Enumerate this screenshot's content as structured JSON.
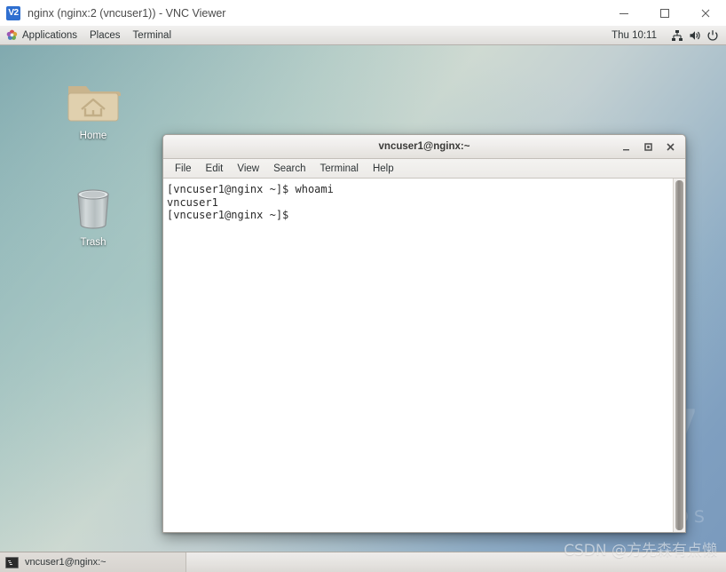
{
  "vnc_window": {
    "app_icon_text": "V2",
    "title": "nginx (nginx:2 (vncuser1)) - VNC Viewer",
    "buttons": {
      "minimize": "minimize-icon",
      "maximize": "maximize-icon",
      "close": "close-icon"
    }
  },
  "gnome_panel": {
    "applications_label": "Applications",
    "places_label": "Places",
    "terminal_label": "Terminal",
    "clock": "Thu 10:11",
    "tray": [
      {
        "name": "network-icon"
      },
      {
        "name": "volume-icon"
      },
      {
        "name": "power-icon"
      }
    ]
  },
  "desktop": {
    "wallpaper_brand_number": "7",
    "wallpaper_brand_text": "ntOS",
    "icons": [
      {
        "name": "home",
        "label": "Home"
      },
      {
        "name": "trash",
        "label": "Trash"
      }
    ]
  },
  "terminal": {
    "title": "vncuser1@nginx:~",
    "menus": [
      {
        "label": "File"
      },
      {
        "label": "Edit"
      },
      {
        "label": "View"
      },
      {
        "label": "Search"
      },
      {
        "label": "Terminal"
      },
      {
        "label": "Help"
      }
    ],
    "buttons": {
      "minimize": "minimize-icon",
      "maximize": "maximize-icon",
      "close": "close-icon"
    },
    "content": "[vncuser1@nginx ~]$ whoami\nvncuser1\n[vncuser1@nginx ~]$ "
  },
  "taskbar": {
    "window_label": "vncuser1@nginx:~"
  },
  "watermark": {
    "text": "CSDN @方先森有点懒"
  },
  "colors": {
    "vnc_accent": "#2f6fd0",
    "panel_bg": "#e7e6e4",
    "terminal_bg": "#ffffff",
    "terminal_fg": "#2b2b2b"
  }
}
